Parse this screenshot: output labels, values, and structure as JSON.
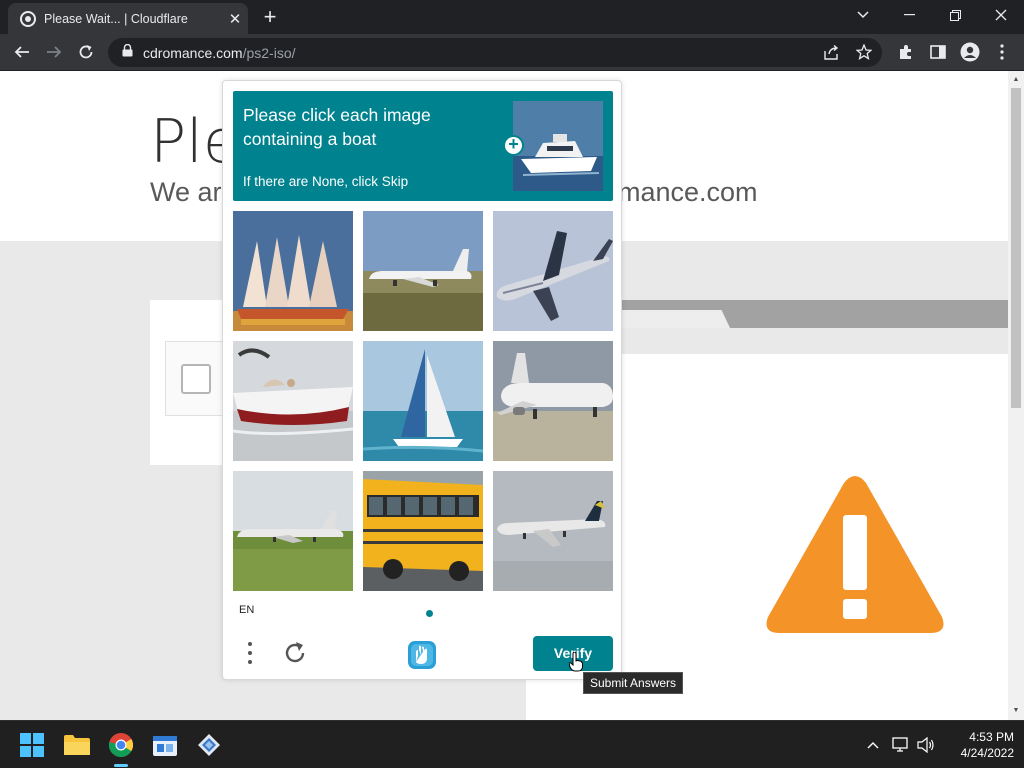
{
  "browser": {
    "tab_title": "Please Wait... | Cloudflare",
    "tab_close": "✕",
    "new_tab": "+",
    "url_domain": "cdromance.com",
    "url_path": "/ps2-iso/"
  },
  "page": {
    "heading": "Please Wait... | Cloudflare",
    "subheading_left": "We ar",
    "subheading_right": "mance.com",
    "warning_color": "#f39328"
  },
  "captcha": {
    "prompt": "Please click each image containing a boat",
    "instruction": "If there are None, click Skip",
    "plus": "+",
    "tiles": [
      {
        "subject": "sailing ship"
      },
      {
        "subject": "airplane on runway"
      },
      {
        "subject": "airplane in flight"
      },
      {
        "subject": "speedboat"
      },
      {
        "subject": "sailboat"
      },
      {
        "subject": "airplane on tarmac"
      },
      {
        "subject": "airplane on runway"
      },
      {
        "subject": "school bus"
      },
      {
        "subject": "airplane landing"
      }
    ],
    "language": "EN",
    "verify_label": "Verify",
    "tooltip": "Submit Answers",
    "accent_color": "#00838f"
  },
  "taskbar": {
    "time": "4:53 PM",
    "date": "4/24/2022"
  }
}
